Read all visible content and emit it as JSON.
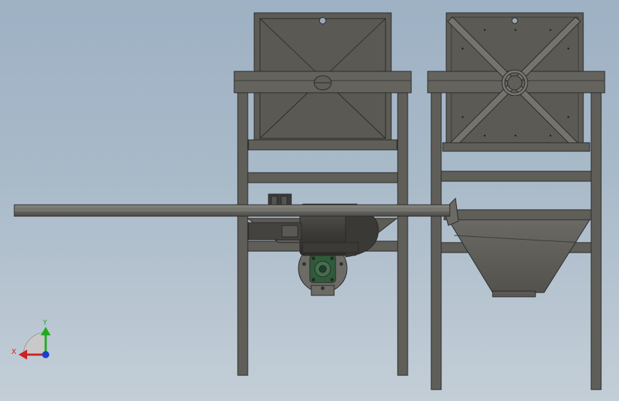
{
  "viewport": {
    "background_top": "#9eb1c4",
    "background_bottom": "#c3ced7"
  },
  "colors": {
    "steel_face": "#5f5e59",
    "steel_light": "#6c6b66",
    "steel_dark": "#45443f",
    "outline": "#2a2a28",
    "motor_green": "#2f5b3a",
    "axis_x": "#cc2222",
    "axis_y": "#22aa22",
    "axis_z": "#1a3fcc"
  },
  "triad": {
    "x_label": "X",
    "y_label": "Y",
    "x_icon": "arrow-left-icon",
    "y_icon": "arrow-up-icon",
    "z_icon": "dot-icon"
  }
}
